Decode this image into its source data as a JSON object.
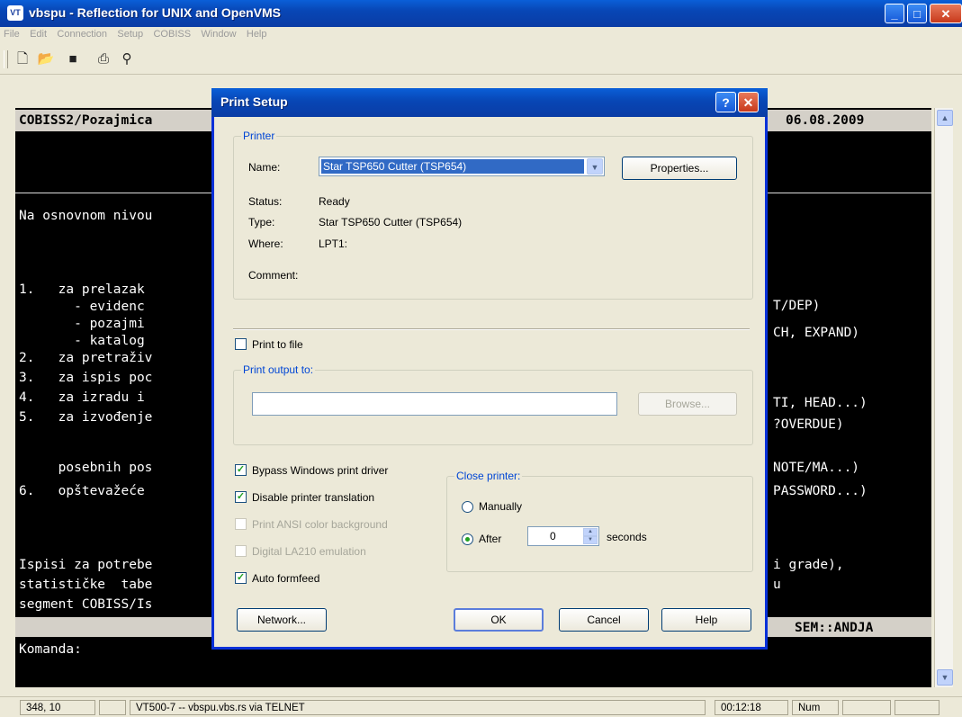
{
  "window": {
    "app_icon": "VT",
    "title": "vbspu - Reflection for UNIX and OpenVMS",
    "controls": [
      "minimize-icon",
      "maximize-icon",
      "close-icon"
    ]
  },
  "menu": [
    "File",
    "Edit",
    "Connection",
    "Setup",
    "COBISS",
    "Window",
    "Help"
  ],
  "toolbar": {
    "icons": [
      "new-icon",
      "open-icon",
      "save-icon",
      "print-icon",
      "find-icon"
    ]
  },
  "terminal": {
    "header_left": "COBISS2/Pozajmica",
    "header_date": "06.08.2009",
    "lines": [
      "Na osnovnom nivou",
      "1.   za prelazak",
      "       - evidenc",
      "       - pozajmi",
      "       - katalog",
      "2.   za pretraživ",
      "3.   za ispis poc",
      "4.   za izradu i",
      "5.   za izvođenje",
      "     posebnih pos",
      "6.   opštevažeće",
      "Ispisi za potrebe",
      "statističke  tabe",
      "segment COBISS/Is"
    ],
    "right_lines": [
      "T/DEP)",
      "CH, EXPAND)",
      "TI, HEAD...)",
      "?OVERDUE)",
      "NOTE/MA...)",
      "PASSWORD...)",
      "i grade),",
      "u"
    ],
    "footer_right": "SEM::ANDJA",
    "command_line": "Komanda:"
  },
  "statusbar": {
    "cursor": "348, 10",
    "connection": "VT500-7 -- vbspu.vbs.rs via TELNET",
    "time": "00:12:18",
    "num": "Num"
  },
  "dialog": {
    "title": "Print Setup",
    "help_glyph": "?",
    "close_glyph": "✕",
    "printer_group": {
      "label": "Printer",
      "name_label": "Name:",
      "name_value": "Star TSP650 Cutter (TSP654)",
      "properties_button": "Properties...",
      "status_label": "Status:",
      "status_value": "Ready",
      "type_label": "Type:",
      "type_value": "Star TSP650 Cutter (TSP654)",
      "where_label": "Where:",
      "where_value": "LPT1:",
      "comment_label": "Comment:"
    },
    "print_to_file": {
      "label": "Print to file",
      "checked": false
    },
    "output_group": {
      "label": "Print output to:",
      "path_value": "",
      "browse_button": "Browse..."
    },
    "options": {
      "bypass": {
        "label": "Bypass Windows print driver",
        "checked": true
      },
      "disable_translation": {
        "label": "Disable printer translation",
        "checked": true
      },
      "ansi_background": {
        "label": "Print ANSI color background",
        "checked": false,
        "disabled": true
      },
      "la210": {
        "label": "Digital LA210 emulation",
        "checked": false,
        "disabled": true
      },
      "auto_formfeed": {
        "label": "Auto formfeed",
        "checked": true
      }
    },
    "close_printer": {
      "label": "Close printer:",
      "manually": "Manually",
      "after": "After",
      "seconds_value": "0",
      "seconds_label": "seconds",
      "selected": "after"
    },
    "buttons": {
      "network": "Network...",
      "ok": "OK",
      "cancel": "Cancel",
      "help": "Help"
    }
  }
}
